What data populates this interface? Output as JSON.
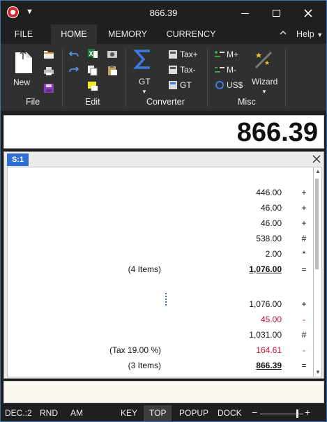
{
  "window": {
    "title": "866.39"
  },
  "tabs": {
    "file": "FILE",
    "home": "HOME",
    "memory": "MEMORY",
    "currency": "CURRENCY",
    "help": "Help"
  },
  "ribbon": {
    "new_label": "New",
    "groups": {
      "file": "File",
      "edit": "Edit",
      "converter": "Converter",
      "misc": "Misc"
    },
    "gt_label": "GT",
    "tax_plus": "Tax+",
    "tax_minus": "Tax-",
    "gt_small": "GT",
    "m_plus": "M+",
    "m_minus": "M-",
    "usd": "US$",
    "wizard": "Wizard"
  },
  "display": {
    "value": "866.39"
  },
  "tape": {
    "tab_label": "S:1",
    "rows": [
      {
        "label": "",
        "value": "446.00",
        "op": "+"
      },
      {
        "label": "",
        "value": "46.00",
        "op": "+"
      },
      {
        "label": "",
        "value": "46.00",
        "op": "+"
      },
      {
        "label": "",
        "value": "538.00",
        "op": "#"
      },
      {
        "label": "",
        "value": "2.00",
        "op": "*"
      },
      {
        "label": "(4 Items)",
        "value": "1,076.00",
        "op": "="
      },
      {
        "label": "",
        "value": "1,076.00",
        "op": "+"
      },
      {
        "label": "",
        "value": "45.00",
        "op": "-"
      },
      {
        "label": "",
        "value": "1,031.00",
        "op": "#"
      },
      {
        "label": "(Tax 19.00 %)",
        "value": "164.61",
        "op": "-"
      },
      {
        "label": "(3 Items)",
        "value": "866.39",
        "op": "="
      }
    ]
  },
  "status": {
    "dec": "DEC.:2",
    "rnd": "RND",
    "am": "AM",
    "key": "KEY",
    "top": "TOP",
    "popup": "POPUP",
    "dock": "DOCK"
  },
  "colors": {
    "accent": "#2f6fd1",
    "negative": "#c8102e",
    "chrome": "#1f1f1f",
    "ribbon": "#303030"
  }
}
